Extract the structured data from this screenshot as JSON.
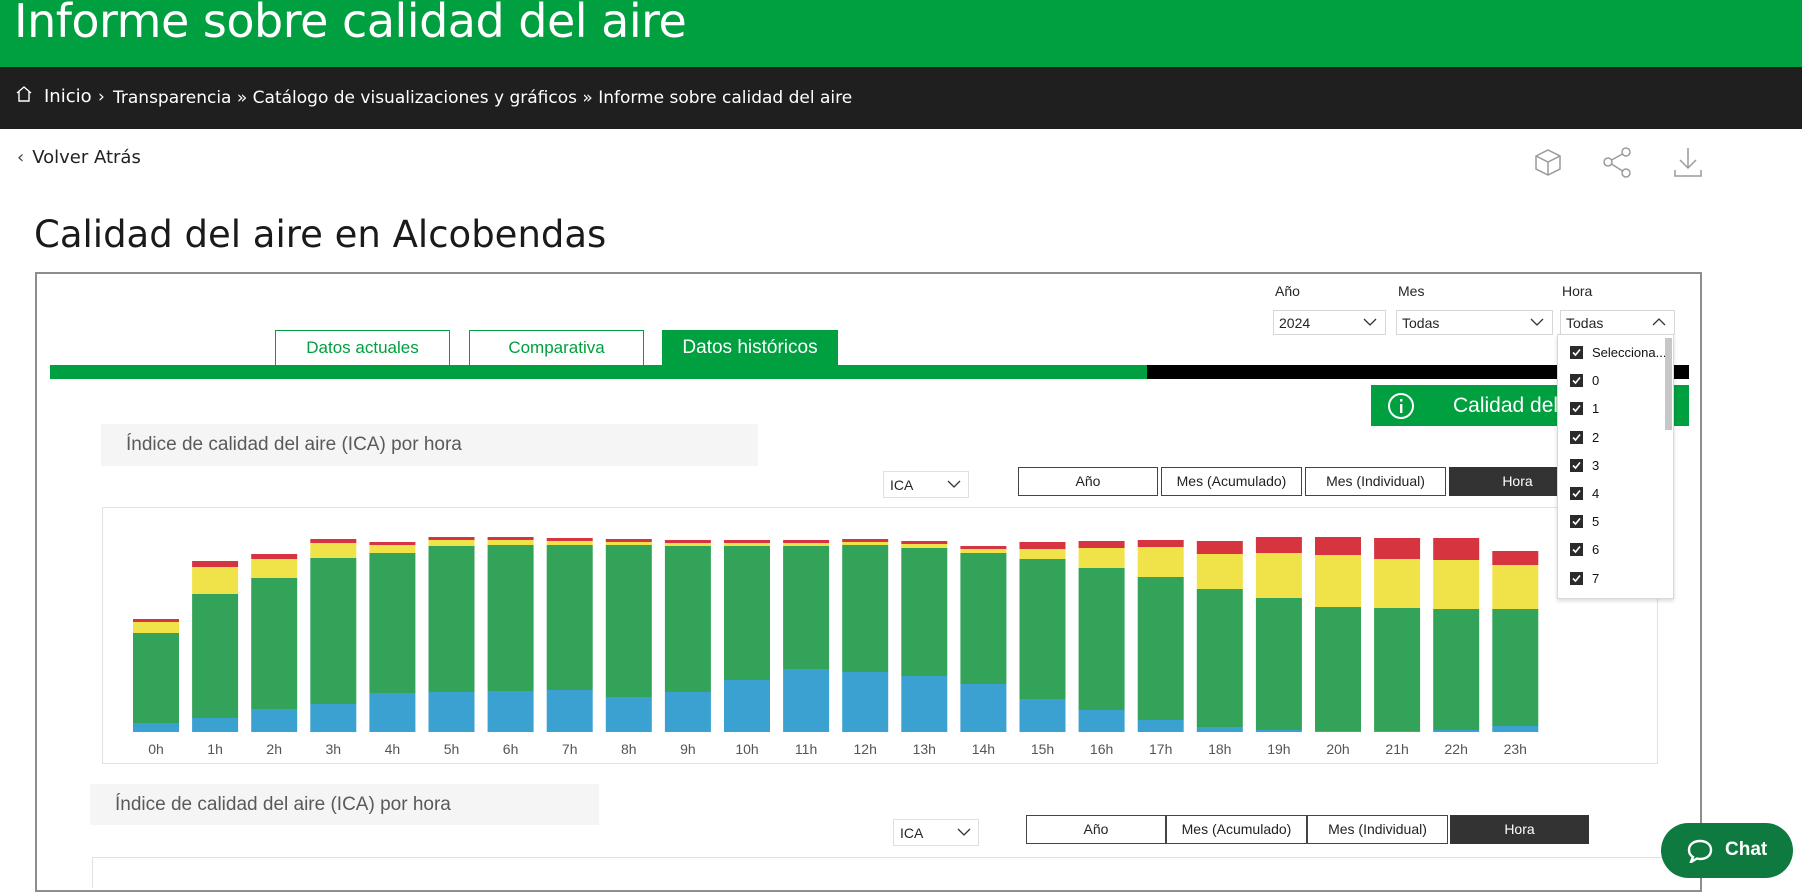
{
  "header": {
    "title": "Informe sobre calidad del aire"
  },
  "breadcrumb": {
    "home": "Inicio",
    "separator": "›",
    "trail": "Transparencia » Catálogo de visualizaciones y gráficos » Informe sobre calidad del aire"
  },
  "back": {
    "label": "Volver Atrás"
  },
  "toolbar_icons": [
    "cube-icon",
    "share-icon",
    "download-icon"
  ],
  "page_title": "Calidad del aire en Alcobendas",
  "filters": {
    "year": {
      "label": "Año",
      "value": "2024"
    },
    "month": {
      "label": "Mes",
      "value": "Todas"
    },
    "hour": {
      "label": "Hora",
      "value": "Todas"
    }
  },
  "tabs": [
    {
      "label": "Datos actuales",
      "active": false
    },
    {
      "label": "Comparativa",
      "active": false
    },
    {
      "label": "Datos históricos",
      "active": true
    }
  ],
  "calidad_button": {
    "label": "Calidad del aire"
  },
  "section1": {
    "title": "Índice de calidad del aire (ICA) por hora",
    "metric": "ICA",
    "segments": [
      "Año",
      "Mes (Acumulado)",
      "Mes (Individual)",
      "Hora"
    ],
    "active_segment": "Hora"
  },
  "section2": {
    "title": "Índice de calidad del aire (ICA) por hora",
    "metric": "ICA",
    "segments": [
      "Año",
      "Mes (Acumulado)",
      "Mes (Individual)",
      "Hora"
    ],
    "active_segment": "Hora"
  },
  "hour_dropdown": {
    "items": [
      "Selecciona...",
      "0",
      "1",
      "2",
      "3",
      "4",
      "5",
      "6",
      "7"
    ],
    "checked": true
  },
  "chat": {
    "label": "Chat"
  },
  "colors": {
    "brand_green": "#009f3f",
    "dark_bar": "#1f1f1f",
    "good_blue": "#3aa1d1",
    "fair_green": "#34a35a",
    "moderate_yellow": "#f0e34a",
    "bad_red": "#d6343f"
  },
  "chart_data": {
    "type": "bar",
    "stacked": true,
    "categories": [
      "0h",
      "1h",
      "2h",
      "3h",
      "4h",
      "5h",
      "6h",
      "7h",
      "8h",
      "9h",
      "10h",
      "11h",
      "12h",
      "13h",
      "14h",
      "15h",
      "16h",
      "17h",
      "18h",
      "19h",
      "20h",
      "21h",
      "22h",
      "23h"
    ],
    "series": [
      {
        "color": "#3aa1d1",
        "values": [
          9,
          14,
          23,
          28,
          39,
          40,
          41,
          42,
          35,
          40,
          52,
          63,
          60,
          56,
          48,
          33,
          22,
          12,
          5,
          2,
          1,
          1,
          2,
          6
        ]
      },
      {
        "color": "#34a35a",
        "values": [
          90,
          124,
          131,
          146,
          140,
          146,
          146,
          145,
          152,
          146,
          134,
          123,
          127,
          128,
          131,
          140,
          142,
          143,
          138,
          132,
          124,
          123,
          121,
          117
        ]
      },
      {
        "color": "#f0e34a",
        "values": [
          11,
          27,
          19,
          15,
          8,
          6,
          5,
          4,
          3,
          3,
          3,
          3,
          3,
          4,
          4,
          10,
          20,
          30,
          35,
          45,
          52,
          49,
          49,
          44
        ]
      },
      {
        "color": "#d6343f",
        "values": [
          3,
          6,
          5,
          4,
          3,
          3,
          3,
          3,
          3,
          3,
          3,
          3,
          3,
          3,
          3,
          7,
          7,
          7,
          13,
          16,
          18,
          21,
          22,
          14
        ]
      }
    ],
    "grid": false
  }
}
